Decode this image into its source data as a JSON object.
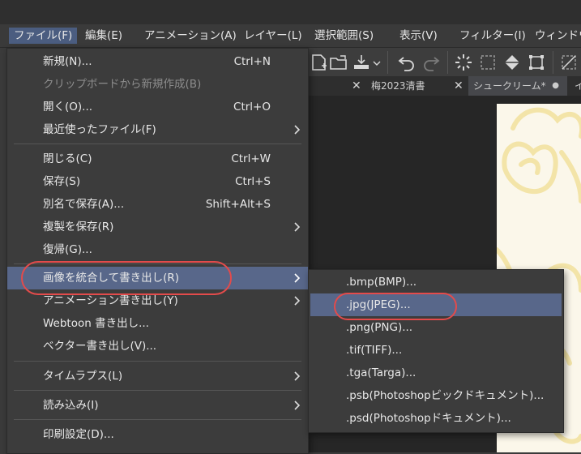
{
  "menubar": {
    "items": [
      "ファイル(F)",
      "編集(E)",
      "アニメーション(A)",
      "レイヤー(L)",
      "選択範囲(S)",
      "表示(V)",
      "フィルター(I)",
      "ウィンドウ"
    ]
  },
  "tabs": [
    {
      "label": "梅2023清書"
    },
    {
      "label": "シュークリーム*"
    },
    {
      "label": "イ"
    }
  ],
  "file_menu": {
    "items": [
      {
        "label": "新規(N)...",
        "shortcut": "Ctrl+N"
      },
      {
        "label": "クリップボードから新規作成(B)"
      },
      {
        "label": "開く(O)...",
        "shortcut": "Ctrl+O"
      },
      {
        "label": "最近使ったファイル(F)"
      },
      {
        "label": "閉じる(C)",
        "shortcut": "Ctrl+W"
      },
      {
        "label": "保存(S)",
        "shortcut": "Ctrl+S"
      },
      {
        "label": "別名で保存(A)...",
        "shortcut": "Shift+Alt+S"
      },
      {
        "label": "複製を保存(R)"
      },
      {
        "label": "復帰(G)..."
      },
      {
        "label": "画像を統合して書き出し(R)"
      },
      {
        "label": "アニメーション書き出し(Y)"
      },
      {
        "label": "Webtoon 書き出し..."
      },
      {
        "label": "ベクター書き出し(V)..."
      },
      {
        "label": "タイムラプス(L)"
      },
      {
        "label": "読み込み(I)"
      },
      {
        "label": "印刷設定(D)..."
      }
    ]
  },
  "export_submenu": {
    "items": [
      {
        "label": ".bmp(BMP)..."
      },
      {
        "label": ".jpg(JPEG)..."
      },
      {
        "label": ".png(PNG)..."
      },
      {
        "label": ".tif(TIFF)..."
      },
      {
        "label": ".tga(Targa)..."
      },
      {
        "label": ".psb(Photoshopビックドキュメント)..."
      },
      {
        "label": ".psd(Photoshopドキュメント)..."
      }
    ]
  },
  "colors": {
    "highlight": "#58678a",
    "annotation_circle": "#e34b4b",
    "menu_bg": "#3c3c3c"
  },
  "icons": [
    "new-file-icon",
    "open-folder-icon",
    "export-icon",
    "undo-icon",
    "redo-icon",
    "loading-icon",
    "select-icon",
    "fill-icon",
    "transform-icon",
    "close-icon",
    "chevron-right-icon"
  ]
}
